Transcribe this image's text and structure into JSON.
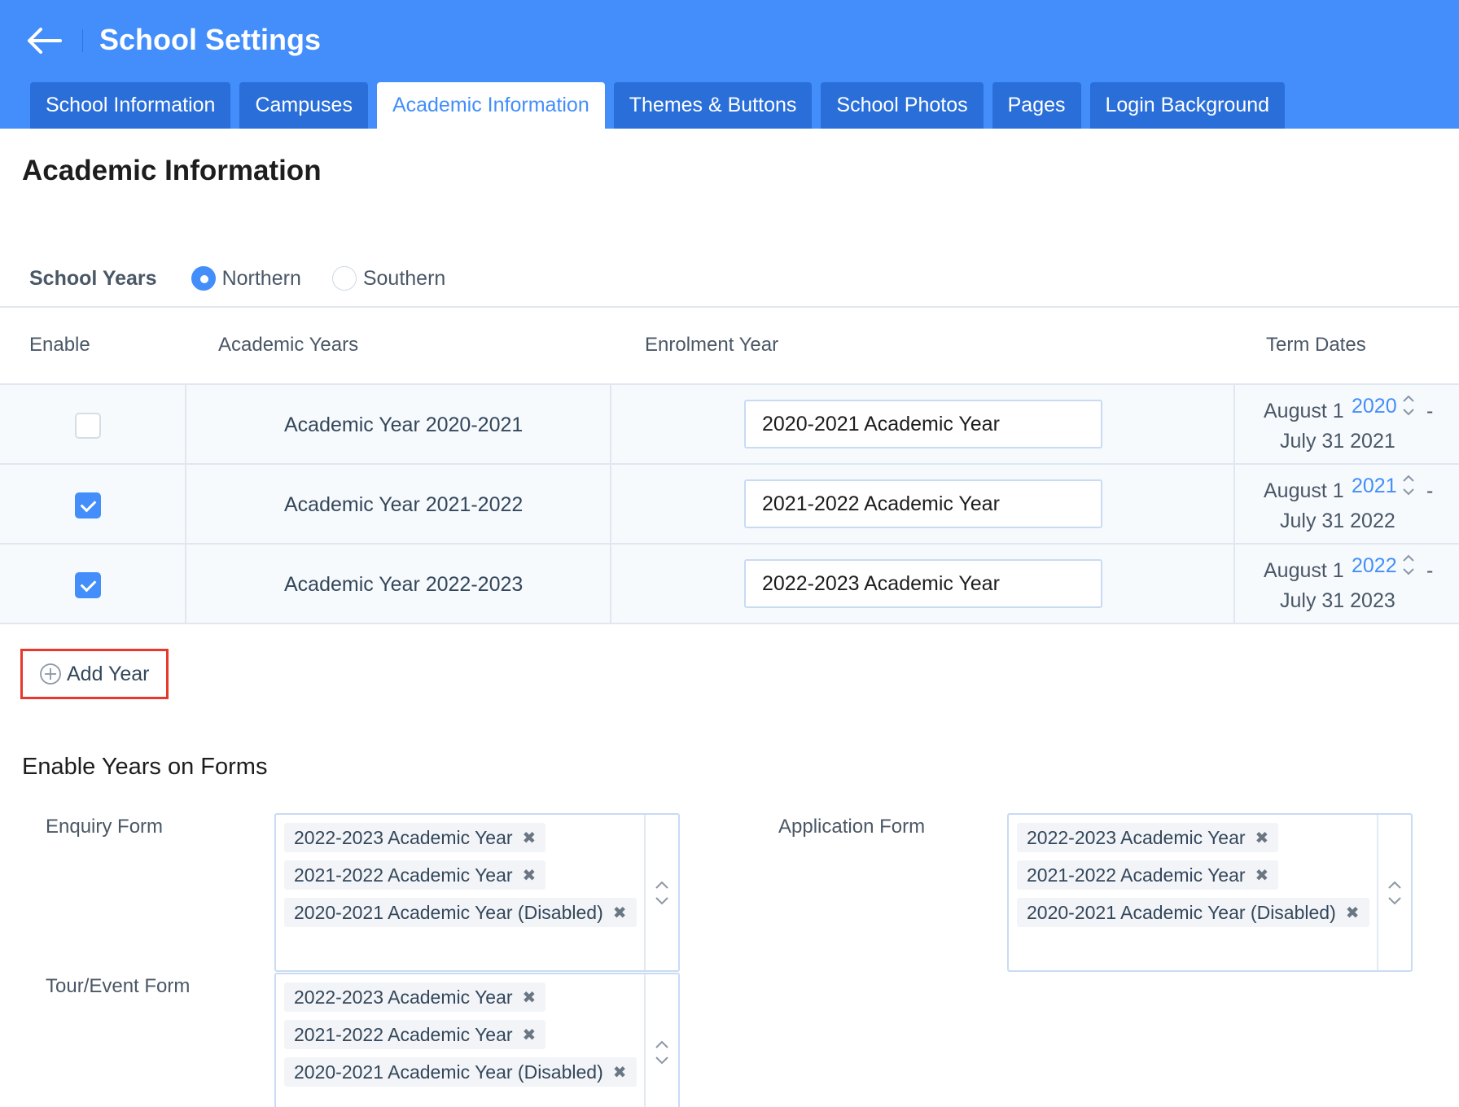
{
  "header": {
    "title": "School Settings",
    "tabs": [
      {
        "label": "School Information"
      },
      {
        "label": "Campuses"
      },
      {
        "label": "Academic Information",
        "active": true
      },
      {
        "label": "Themes & Buttons"
      },
      {
        "label": "School Photos"
      },
      {
        "label": "Pages"
      },
      {
        "label": "Login Background"
      }
    ]
  },
  "page": {
    "title": "Academic Information",
    "school_years": {
      "label": "School Years",
      "options": [
        "Northern",
        "Southern"
      ],
      "selected": "Northern"
    },
    "table": {
      "headers": [
        "Enable",
        "Academic Years",
        "Enrolment Year",
        "Term Dates"
      ],
      "rows": [
        {
          "enabled": false,
          "academic_year": "Academic Year 2020-2021",
          "enrolment_year": "2020-2021 Academic Year",
          "term_start": "August 1",
          "term_start_year": "2020",
          "term_dash": "-",
          "term_end": "July 31 2021"
        },
        {
          "enabled": true,
          "academic_year": "Academic Year 2021-2022",
          "enrolment_year": "2021-2022 Academic Year",
          "term_start": "August 1",
          "term_start_year": "2021",
          "term_dash": "-",
          "term_end": "July 31 2022"
        },
        {
          "enabled": true,
          "academic_year": "Academic Year 2022-2023",
          "enrolment_year": "2022-2023 Academic Year",
          "term_start": "August 1",
          "term_start_year": "2022",
          "term_dash": "-",
          "term_end": "July 31 2023"
        }
      ]
    },
    "add_year_label": "Add Year",
    "forms_section": {
      "title": "Enable Years on Forms",
      "forms": [
        {
          "label": "Enquiry Form",
          "selected": [
            "2022-2023 Academic Year",
            "2021-2022 Academic Year",
            "2020-2021 Academic Year (Disabled)"
          ]
        },
        {
          "label": "Application Form",
          "selected": [
            "2022-2023 Academic Year",
            "2021-2022 Academic Year",
            "2020-2021 Academic Year (Disabled)"
          ]
        },
        {
          "label": "Tour/Event Form",
          "selected": [
            "2022-2023 Academic Year",
            "2021-2022 Academic Year",
            "2020-2021 Academic Year (Disabled)"
          ]
        }
      ]
    }
  },
  "colors": {
    "header_bg": "#438efa",
    "tab_bg": "#2a6fd9",
    "accent": "#438efa",
    "highlight_box": "#e8382c"
  },
  "icons": {
    "back": "arrow-left-icon",
    "add": "plus-circle-icon",
    "chip_remove": "close-icon",
    "spinner": "chevron-up-down-icon"
  }
}
